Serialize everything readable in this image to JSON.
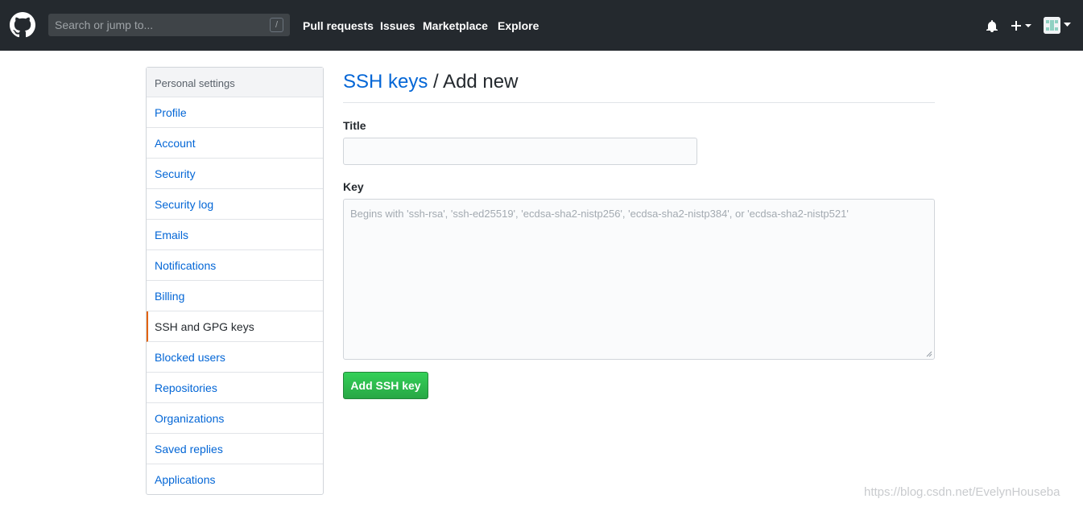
{
  "header": {
    "search_placeholder": "Search or jump to...",
    "search_shortcut": "/",
    "nav": [
      "Pull requests",
      "Issues",
      "Marketplace",
      "Explore"
    ],
    "icons": [
      "github-logo-icon",
      "bell-icon",
      "plus-icon",
      "avatar-icon"
    ]
  },
  "sidebar": {
    "heading": "Personal settings",
    "items": [
      {
        "label": "Profile"
      },
      {
        "label": "Account"
      },
      {
        "label": "Security"
      },
      {
        "label": "Security log"
      },
      {
        "label": "Emails"
      },
      {
        "label": "Notifications"
      },
      {
        "label": "Billing"
      },
      {
        "label": "SSH and GPG keys",
        "selected": true
      },
      {
        "label": "Blocked users"
      },
      {
        "label": "Repositories"
      },
      {
        "label": "Organizations"
      },
      {
        "label": "Saved replies"
      },
      {
        "label": "Applications"
      }
    ]
  },
  "main": {
    "title_link": "SSH keys",
    "title_rest": " / Add new",
    "title_label": "Title",
    "title_value": "",
    "key_label": "Key",
    "key_value": "",
    "key_placeholder": "Begins with 'ssh-rsa', 'ssh-ed25519', 'ecdsa-sha2-nistp256', 'ecdsa-sha2-nistp384', or 'ecdsa-sha2-nistp521'",
    "submit_label": "Add SSH key"
  },
  "watermark": "https://blog.csdn.net/EvelynHouseba",
  "colors": {
    "header_bg": "#24292e",
    "link": "#0366d6",
    "selected_accent": "#e36209",
    "button_green": "#28a745"
  }
}
